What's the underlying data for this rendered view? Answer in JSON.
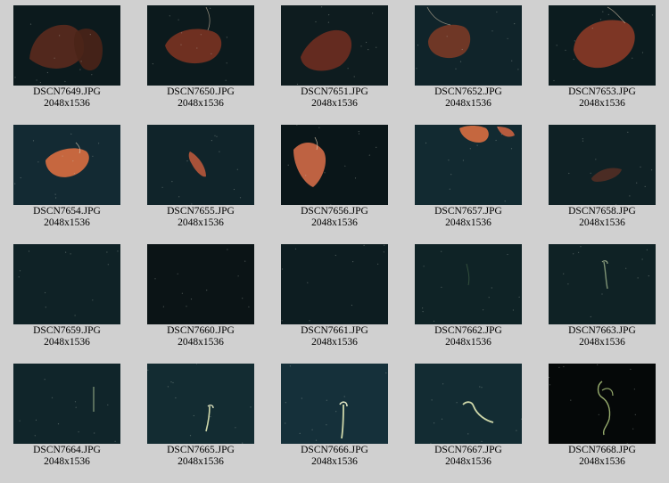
{
  "thumbnails": [
    {
      "filename": "DSCN7649.JPG",
      "dimensions": "2048x1536",
      "scene": "dark-orange-pair",
      "tint": "#0c1a1d"
    },
    {
      "filename": "DSCN7650.JPG",
      "dimensions": "2048x1536",
      "scene": "orange-blob-tentacle",
      "tint": "#0c1a1d"
    },
    {
      "filename": "DSCN7651.JPG",
      "dimensions": "2048x1536",
      "scene": "orange-blob-mid",
      "tint": "#0e1c1f"
    },
    {
      "filename": "DSCN7652.JPG",
      "dimensions": "2048x1536",
      "scene": "orange-ball-tentacle",
      "tint": "#10242a"
    },
    {
      "filename": "DSCN7653.JPG",
      "dimensions": "2048x1536",
      "scene": "orange-large-tentacle",
      "tint": "#0c1c1f"
    },
    {
      "filename": "DSCN7654.JPG",
      "dimensions": "2048x1536",
      "scene": "bright-orange",
      "tint": "#132a33"
    },
    {
      "filename": "DSCN7655.JPG",
      "dimensions": "2048x1536",
      "scene": "small-orange-leaf",
      "tint": "#10242a"
    },
    {
      "filename": "DSCN7656.JPG",
      "dimensions": "2048x1536",
      "scene": "orange-leaf-large",
      "tint": "#0a1619"
    },
    {
      "filename": "DSCN7657.JPG",
      "dimensions": "2048x1536",
      "scene": "orange-top-edge",
      "tint": "#122a31"
    },
    {
      "filename": "DSCN7658.JPG",
      "dimensions": "2048x1536",
      "scene": "faint-orange",
      "tint": "#0f2125"
    },
    {
      "filename": "DSCN7659.JPG",
      "dimensions": "2048x1536",
      "scene": "dark-specks",
      "tint": "#0f2226"
    },
    {
      "filename": "DSCN7660.JPG",
      "dimensions": "2048x1536",
      "scene": "near-black",
      "tint": "#0b1416"
    },
    {
      "filename": "DSCN7661.JPG",
      "dimensions": "2048x1536",
      "scene": "dark-specks",
      "tint": "#0d1d21"
    },
    {
      "filename": "DSCN7662.JPG",
      "dimensions": "2048x1536",
      "scene": "faint-green-stalk",
      "tint": "#0f2326"
    },
    {
      "filename": "DSCN7663.JPG",
      "dimensions": "2048x1536",
      "scene": "green-stalk",
      "tint": "#0f2225"
    },
    {
      "filename": "DSCN7664.JPG",
      "dimensions": "2048x1536",
      "scene": "green-stalk-small",
      "tint": "#10252a"
    },
    {
      "filename": "DSCN7665.JPG",
      "dimensions": "2048x1536",
      "scene": "green-stalk-bright",
      "tint": "#132c32"
    },
    {
      "filename": "DSCN7666.JPG",
      "dimensions": "2048x1536",
      "scene": "green-stalk-bright-long",
      "tint": "#15303a"
    },
    {
      "filename": "DSCN7667.JPG",
      "dimensions": "2048x1536",
      "scene": "green-hook",
      "tint": "#132c33"
    },
    {
      "filename": "DSCN7668.JPG",
      "dimensions": "2048x1536",
      "scene": "green-branch-black",
      "tint": "#050808"
    }
  ]
}
